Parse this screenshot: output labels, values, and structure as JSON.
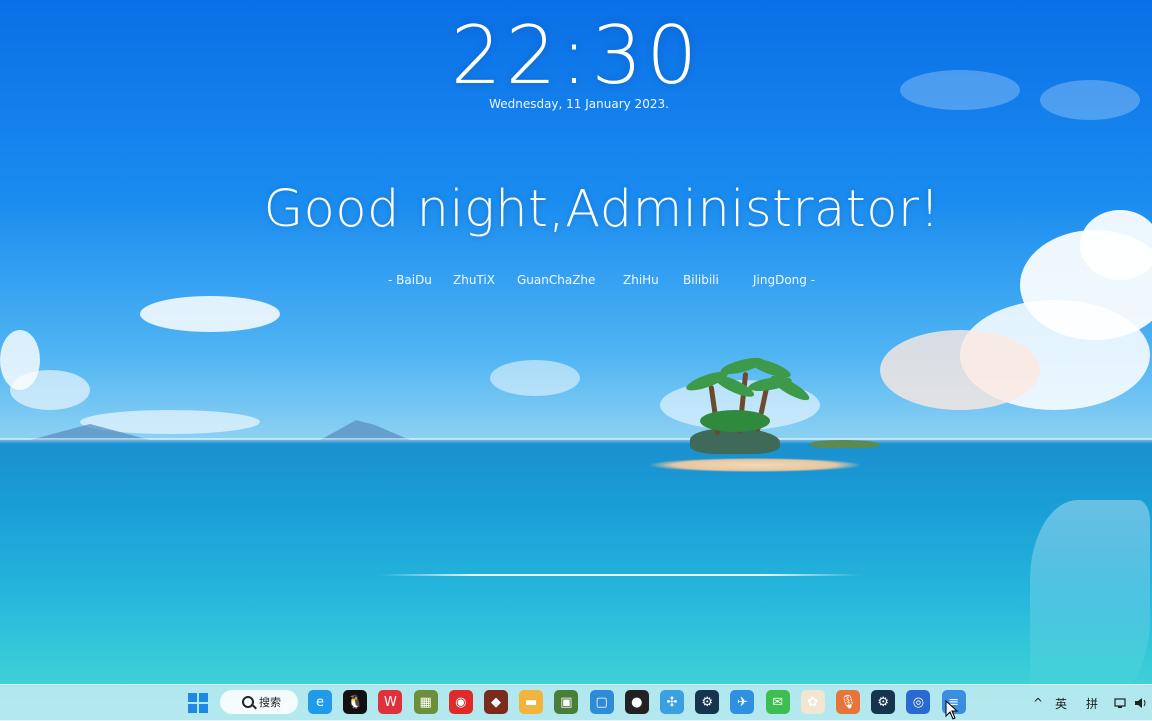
{
  "clock": {
    "time": "22:30",
    "date": "Wednesday, 11 January 2023."
  },
  "greeting": "Good night,Administrator!",
  "quick_links": [
    "- BaiDu",
    "ZhuTiX",
    "GuanChaZhe",
    "ZhiHu",
    "Bilibili",
    "JingDong -"
  ],
  "taskbar": {
    "search_label": "搜索",
    "apps": [
      {
        "icon": "edge-icon",
        "color": "#1f9be8",
        "glyph": "e"
      },
      {
        "icon": "qq-icon",
        "color": "#111111",
        "glyph": "🐧"
      },
      {
        "icon": "weibo-icon",
        "color": "#e0303b",
        "glyph": "W"
      },
      {
        "icon": "minecraft-icon",
        "color": "#6c8f3a",
        "glyph": "▦"
      },
      {
        "icon": "netease-music-icon",
        "color": "#e02a2a",
        "glyph": "◉"
      },
      {
        "icon": "game-avatar-icon",
        "color": "#7a2b1c",
        "glyph": "◆"
      },
      {
        "icon": "file-explorer-icon",
        "color": "#f2b43a",
        "glyph": "▬"
      },
      {
        "icon": "game-launcher-icon",
        "color": "#4a7d3a",
        "glyph": "▣"
      },
      {
        "icon": "vmware-icon",
        "color": "#2e8bd8",
        "glyph": "▢"
      },
      {
        "icon": "obs-icon",
        "color": "#222222",
        "glyph": "●"
      },
      {
        "icon": "pinwheel-icon",
        "color": "#3aa0e0",
        "glyph": "✣"
      },
      {
        "icon": "steam-icon",
        "color": "#15354f",
        "glyph": "⚙"
      },
      {
        "icon": "telegram-icon",
        "color": "#2f8fe0",
        "glyph": "✈"
      },
      {
        "icon": "wechat-icon",
        "color": "#3cbf50",
        "glyph": "✉"
      },
      {
        "icon": "anime-app-icon",
        "color": "#f0e6d2",
        "glyph": "✿"
      },
      {
        "icon": "microphone-icon",
        "color": "#e8743a",
        "glyph": "🎙"
      },
      {
        "icon": "steam-2-icon",
        "color": "#15354f",
        "glyph": "⚙"
      },
      {
        "icon": "remote-desktop-icon",
        "color": "#2a6ad0",
        "glyph": "◎"
      },
      {
        "icon": "notepad-icon",
        "color": "#3a8ee0",
        "glyph": "≡"
      }
    ],
    "tray": {
      "chevron": "^",
      "ime_lang": "英",
      "ime_mode": "拼"
    }
  }
}
